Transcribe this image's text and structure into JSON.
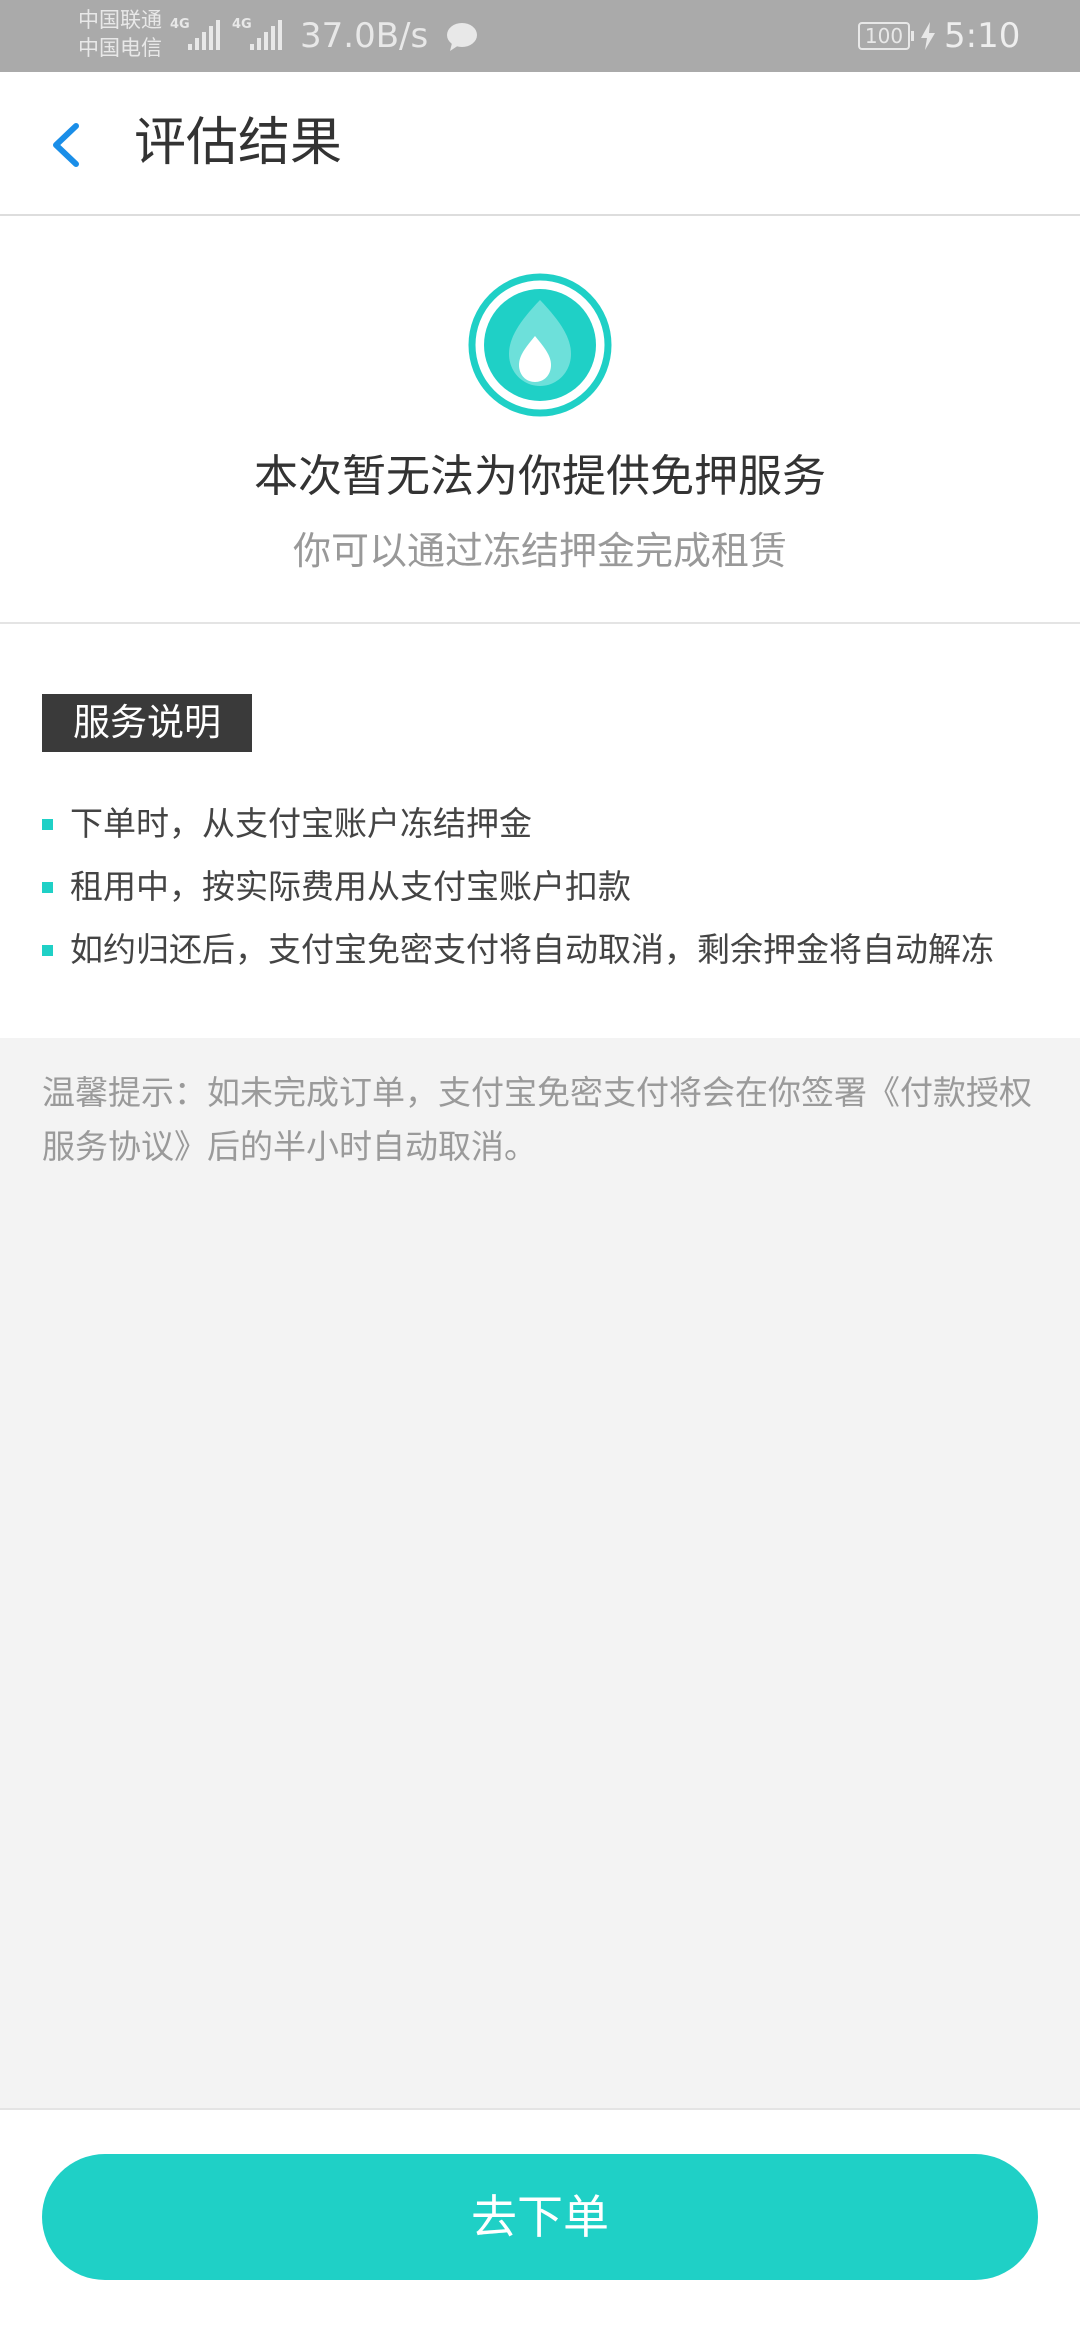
{
  "status_bar": {
    "carrier_1": "中国联通",
    "carrier_2": "中国电信",
    "network_1": "4G",
    "network_2": "4G",
    "net_speed": "37.0B/s",
    "battery": "100",
    "time": "5:10",
    "icons": [
      "signal-icon",
      "message-icon",
      "battery-icon",
      "charging-icon"
    ]
  },
  "header": {
    "back_icon": "chevron-left-icon",
    "title": "评估结果"
  },
  "result": {
    "icon": "droplet-icon",
    "title": "本次暂无法为你提供免押服务",
    "subtitle": "你可以通过冻结押金完成租赁"
  },
  "service": {
    "label": "服务说明",
    "items": [
      "下单时，从支付宝账户冻结押金",
      "租用中，按实际费用从支付宝账户扣款",
      "如约归还后，支付宝免密支付将自动取消，剩余押金将自动解冻"
    ]
  },
  "tip": "温馨提示：如未完成订单，支付宝免密支付将会在你签署《付款授权服务协议》后的半小时自动取消。",
  "footer": {
    "button_label": "去下单"
  },
  "colors": {
    "accent": "#1fd0c6",
    "back_arrow": "#1a8ee8",
    "status_bar": "#aaaaaa",
    "page_background": "#f3f3f3"
  }
}
